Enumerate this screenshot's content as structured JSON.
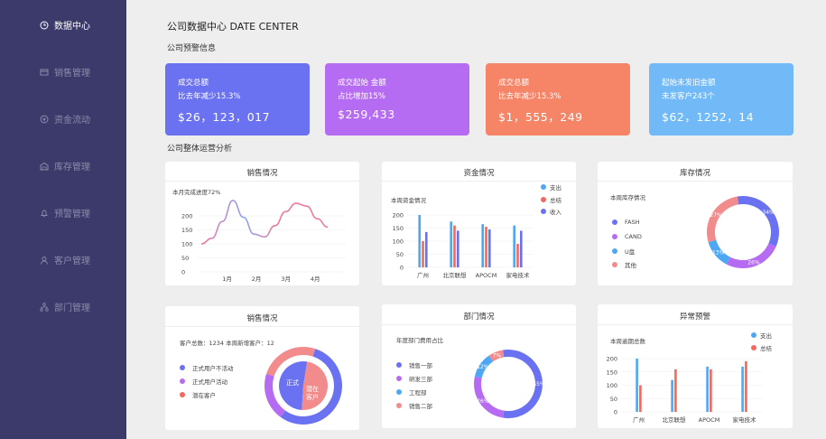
{
  "sidebar": {
    "items": [
      {
        "label": "数据中心",
        "icon": "clock-icon",
        "active": true
      },
      {
        "label": "销售管理",
        "icon": "card-icon",
        "active": false
      },
      {
        "label": "资金流动",
        "icon": "money-icon",
        "active": false
      },
      {
        "label": "库存管理",
        "icon": "warehouse-icon",
        "active": false
      },
      {
        "label": "预警管理",
        "icon": "bell-icon",
        "active": false
      },
      {
        "label": "客户管理",
        "icon": "user-icon",
        "active": false
      },
      {
        "label": "部门管理",
        "icon": "org-icon",
        "active": false
      }
    ]
  },
  "header": {
    "title": "公司数据中心  DATE  CENTER",
    "alert_section": "公司预警信息",
    "analysis_section": "公司整体运营分析"
  },
  "kpis": [
    {
      "label": "成交总额",
      "sub": "比去年减少15.3%",
      "value": "$26，123，017",
      "color": "#6a72f2"
    },
    {
      "label": "成交起始  金额",
      "sub": "占比增加15%",
      "value": "$259,433",
      "color": "#b56cf2"
    },
    {
      "label": "成交总额",
      "sub": "比去年减少15.3%",
      "value": "$1，555，249",
      "color": "#f68466"
    },
    {
      "label": "起始未发旧金额",
      "sub": "未发客户243个",
      "value": "$62，1252，14",
      "color": "#72b9f8"
    }
  ],
  "cards": {
    "sales_trend": {
      "title": "销售情况",
      "subtitle": "本月完成进度72%"
    },
    "funds": {
      "title": "资金情况",
      "subtitle": "本周资金情况",
      "legend": [
        "支出",
        "总结",
        "收入"
      ]
    },
    "inventory": {
      "title": "库存情况",
      "subtitle": "本周库存情况",
      "legend": [
        "FASH",
        "CAND",
        "U盘",
        "其他"
      ]
    },
    "sales_customers": {
      "title": "销售情况",
      "stats": "客户总数：1234     本周新增客户：12",
      "legend": [
        "正式用户不活动",
        "正式用户活动",
        "潜在客户"
      ],
      "inner_labels": [
        "正式",
        "潜在",
        "客户"
      ]
    },
    "department": {
      "title": "部门情况",
      "subtitle": "年度部门费用占比",
      "legend": [
        "销售一部",
        "研发三部",
        "工程部",
        "销售二部"
      ]
    },
    "alerts": {
      "title": "异常预警",
      "subtitle": "本周逾期总数",
      "legend": [
        "支出",
        "总结"
      ]
    }
  },
  "colors": {
    "blue": "#4ea7f3",
    "red": "#f2685f",
    "purple": "#6a72f2",
    "violet": "#b56cf2",
    "pink": "#f28b8b",
    "lightblue": "#62b2f7"
  },
  "chart_data": [
    {
      "type": "line",
      "title": "销售情况",
      "categories": [
        "1月",
        "2月",
        "3月",
        "4月"
      ],
      "x": [
        0,
        0.5,
        1,
        1.5,
        2,
        2.5,
        3,
        3.5,
        4,
        4.5,
        5,
        5.5,
        6
      ],
      "series": [
        {
          "values": [
            100,
            120,
            180,
            255,
            195,
            135,
            125,
            165,
            215,
            245,
            235,
            190,
            160
          ]
        }
      ],
      "ylim": [
        0,
        200
      ],
      "yticks": [
        0,
        50,
        100,
        150,
        200
      ]
    },
    {
      "type": "bar",
      "title": "资金情况",
      "categories": [
        "广州",
        "北京联想",
        "APOCM",
        "家电技术"
      ],
      "series": [
        {
          "name": "支出",
          "values": [
            200,
            175,
            165,
            160
          ]
        },
        {
          "name": "总结",
          "values": [
            100,
            160,
            155,
            90
          ]
        },
        {
          "name": "收入",
          "values": [
            135,
            140,
            145,
            140
          ]
        }
      ],
      "ylim": [
        0,
        200
      ],
      "yticks": [
        0,
        50,
        100,
        150,
        200
      ]
    },
    {
      "type": "pie",
      "title": "库存情况",
      "labels": [
        "FASH",
        "CAND",
        "U盘",
        "其他"
      ],
      "values": [
        34,
        26,
        13,
        27
      ],
      "printed_labels": [
        "34%",
        "26%",
        "13%",
        "27%"
      ]
    },
    {
      "type": "pie",
      "title": "销售情况",
      "labels": [
        "正式用户不活动",
        "正式用户活动",
        "潜在客户"
      ],
      "values": [
        55,
        20,
        25
      ]
    },
    {
      "type": "pie",
      "title": "部门情况",
      "labels": [
        "销售一部",
        "研发三部",
        "工程部",
        "销售二部"
      ],
      "values": [
        55,
        26,
        12,
        7
      ],
      "printed_labels": [
        "55%",
        "26%",
        "12%",
        "7%"
      ]
    },
    {
      "type": "bar",
      "title": "异常预警",
      "categories": [
        "广州",
        "北京联想",
        "APOCM",
        "家电技术"
      ],
      "series": [
        {
          "name": "支出",
          "values": [
            200,
            120,
            170,
            170
          ]
        },
        {
          "name": "总结",
          "values": [
            100,
            160,
            160,
            190
          ]
        }
      ],
      "ylim": [
        0,
        200
      ],
      "yticks": [
        0,
        50,
        100,
        150,
        200
      ]
    }
  ]
}
